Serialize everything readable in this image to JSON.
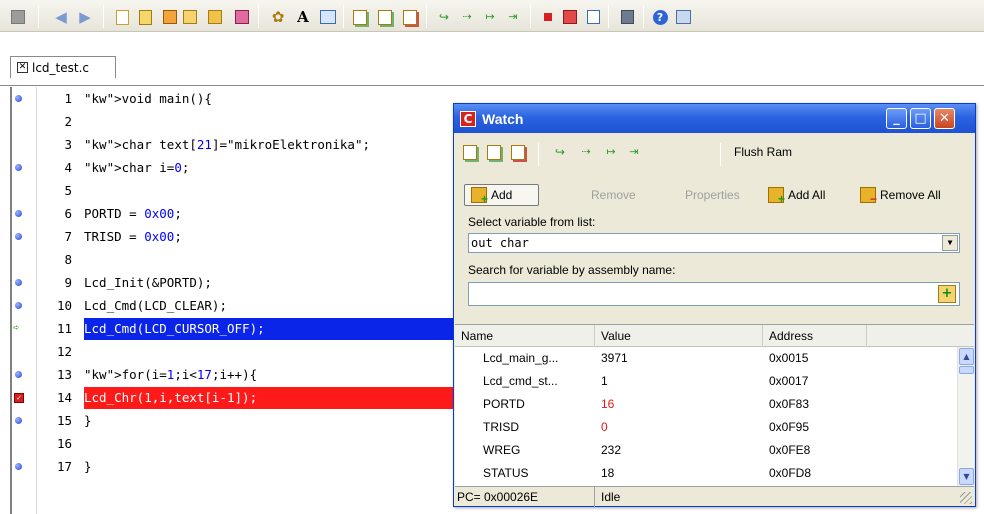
{
  "toolbar": {
    "icons": [
      "save-icon",
      "back-icon",
      "forward-icon",
      "copy-icon",
      "paste-icon",
      "project-icon",
      "edit-project-icon",
      "options-icon",
      "tools-icon",
      "font-icon",
      "image-icon",
      "build-icon",
      "build-all-icon",
      "clean-icon",
      "step-into-icon",
      "step-over-icon",
      "step-out-icon",
      "run-to-cursor-icon",
      "stop-icon",
      "toggle-breakpoint-icon",
      "breakpoints-list-icon",
      "window-icon",
      "help-icon",
      "exit-icon"
    ]
  },
  "editor": {
    "tab_label": "lcd_test.c",
    "tab_close": "✕",
    "lines": [
      {
        "no": "1",
        "marker": "dot",
        "code": "void main(){"
      },
      {
        "no": "2",
        "marker": "",
        "code": ""
      },
      {
        "no": "3",
        "marker": "",
        "code": "char text[21]=\"mikroElektronika\";"
      },
      {
        "no": "4",
        "marker": "dot",
        "code": "char i=0;"
      },
      {
        "no": "5",
        "marker": "",
        "code": ""
      },
      {
        "no": "6",
        "marker": "dot",
        "code": "PORTD = 0x00;"
      },
      {
        "no": "7",
        "marker": "dot",
        "code": "TRISD = 0x00;"
      },
      {
        "no": "8",
        "marker": "",
        "code": ""
      },
      {
        "no": "9",
        "marker": "dot",
        "code": "Lcd_Init(&PORTD);"
      },
      {
        "no": "10",
        "marker": "dot",
        "code": "Lcd_Cmd(LCD_CLEAR);"
      },
      {
        "no": "11",
        "marker": "arrow",
        "code": "Lcd_Cmd(LCD_CURSOR_OFF);"
      },
      {
        "no": "12",
        "marker": "",
        "code": ""
      },
      {
        "no": "13",
        "marker": "dot",
        "code": "for(i=1;i<17;i++){"
      },
      {
        "no": "14",
        "marker": "bp",
        "code": "Lcd_Chr(1,i,text[i-1]);"
      },
      {
        "no": "15",
        "marker": "dot",
        "code": "}"
      },
      {
        "no": "16",
        "marker": "",
        "code": ""
      },
      {
        "no": "17",
        "marker": "dot",
        "code": "}"
      }
    ]
  },
  "watch": {
    "title": "Watch",
    "title_icon": "C",
    "toolbar_icons": [
      "watch-build-icon",
      "watch-build-all-icon",
      "watch-clean-icon",
      "watch-step-into-icon",
      "watch-step-over-icon",
      "watch-step-out-icon",
      "watch-run-to-cursor-icon"
    ],
    "flush_ram": "Flush Ram",
    "add": "Add",
    "remove": "Remove",
    "properties": "Properties",
    "add_all": "Add All",
    "remove_all": "Remove All",
    "select_label": "Select variable from list:",
    "selected_variable": "out char",
    "search_label": "Search for variable by assembly name:",
    "search_value": "",
    "columns": [
      "Name",
      "Value",
      "Address"
    ],
    "rows": [
      {
        "name": "Lcd_main_g...",
        "value": "3971",
        "address": "0x0015",
        "changed": false
      },
      {
        "name": "Lcd_cmd_st...",
        "value": "1",
        "address": "0x0017",
        "changed": false
      },
      {
        "name": "PORTD",
        "value": "16",
        "address": "0x0F83",
        "changed": true
      },
      {
        "name": "TRISD",
        "value": "0",
        "address": "0x0F95",
        "changed": true
      },
      {
        "name": "WREG",
        "value": "232",
        "address": "0x0FE8",
        "changed": false
      },
      {
        "name": "STATUS",
        "value": "18",
        "address": "0x0FD8",
        "changed": false
      }
    ],
    "status_pc": "PC= 0x00026E",
    "status_state": "Idle"
  }
}
